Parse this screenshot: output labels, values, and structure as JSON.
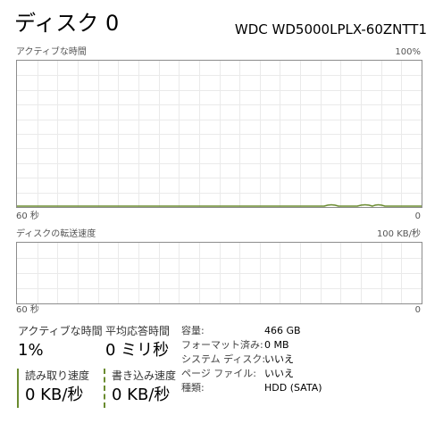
{
  "header": {
    "title": "ディスク 0",
    "model": "WDC WD5000LPLX-60ZNTT1"
  },
  "active_time_graph": {
    "label": "アクティブな時間",
    "max_label": "100%",
    "time_label": "60 秒",
    "min_label": "0"
  },
  "transfer_graph": {
    "label": "ディスクの転送速度",
    "max_label": "100 KB/秒",
    "time_label": "60 秒",
    "min_label": "0"
  },
  "stats": {
    "active_time": {
      "label": "アクティブな時間",
      "value": "1%"
    },
    "avg_response": {
      "label": "平均応答時間",
      "value": "0 ミリ秒"
    },
    "read_speed": {
      "label": "読み取り速度",
      "value": "0 KB/秒"
    },
    "write_speed": {
      "label": "書き込み速度",
      "value": "0 KB/秒"
    }
  },
  "properties": [
    {
      "label": "容量:",
      "value": "466 GB"
    },
    {
      "label": "フォーマット済み:",
      "value": "0 MB"
    },
    {
      "label": "システム ディスク:",
      "value": "いいえ"
    },
    {
      "label": "ページ ファイル:",
      "value": "いいえ"
    },
    {
      "label": "種類:",
      "value": "HDD (SATA)"
    }
  ],
  "colors": {
    "accent": "#6a8b2f",
    "grid": "#eaeaea",
    "border": "#8c8c8c"
  }
}
